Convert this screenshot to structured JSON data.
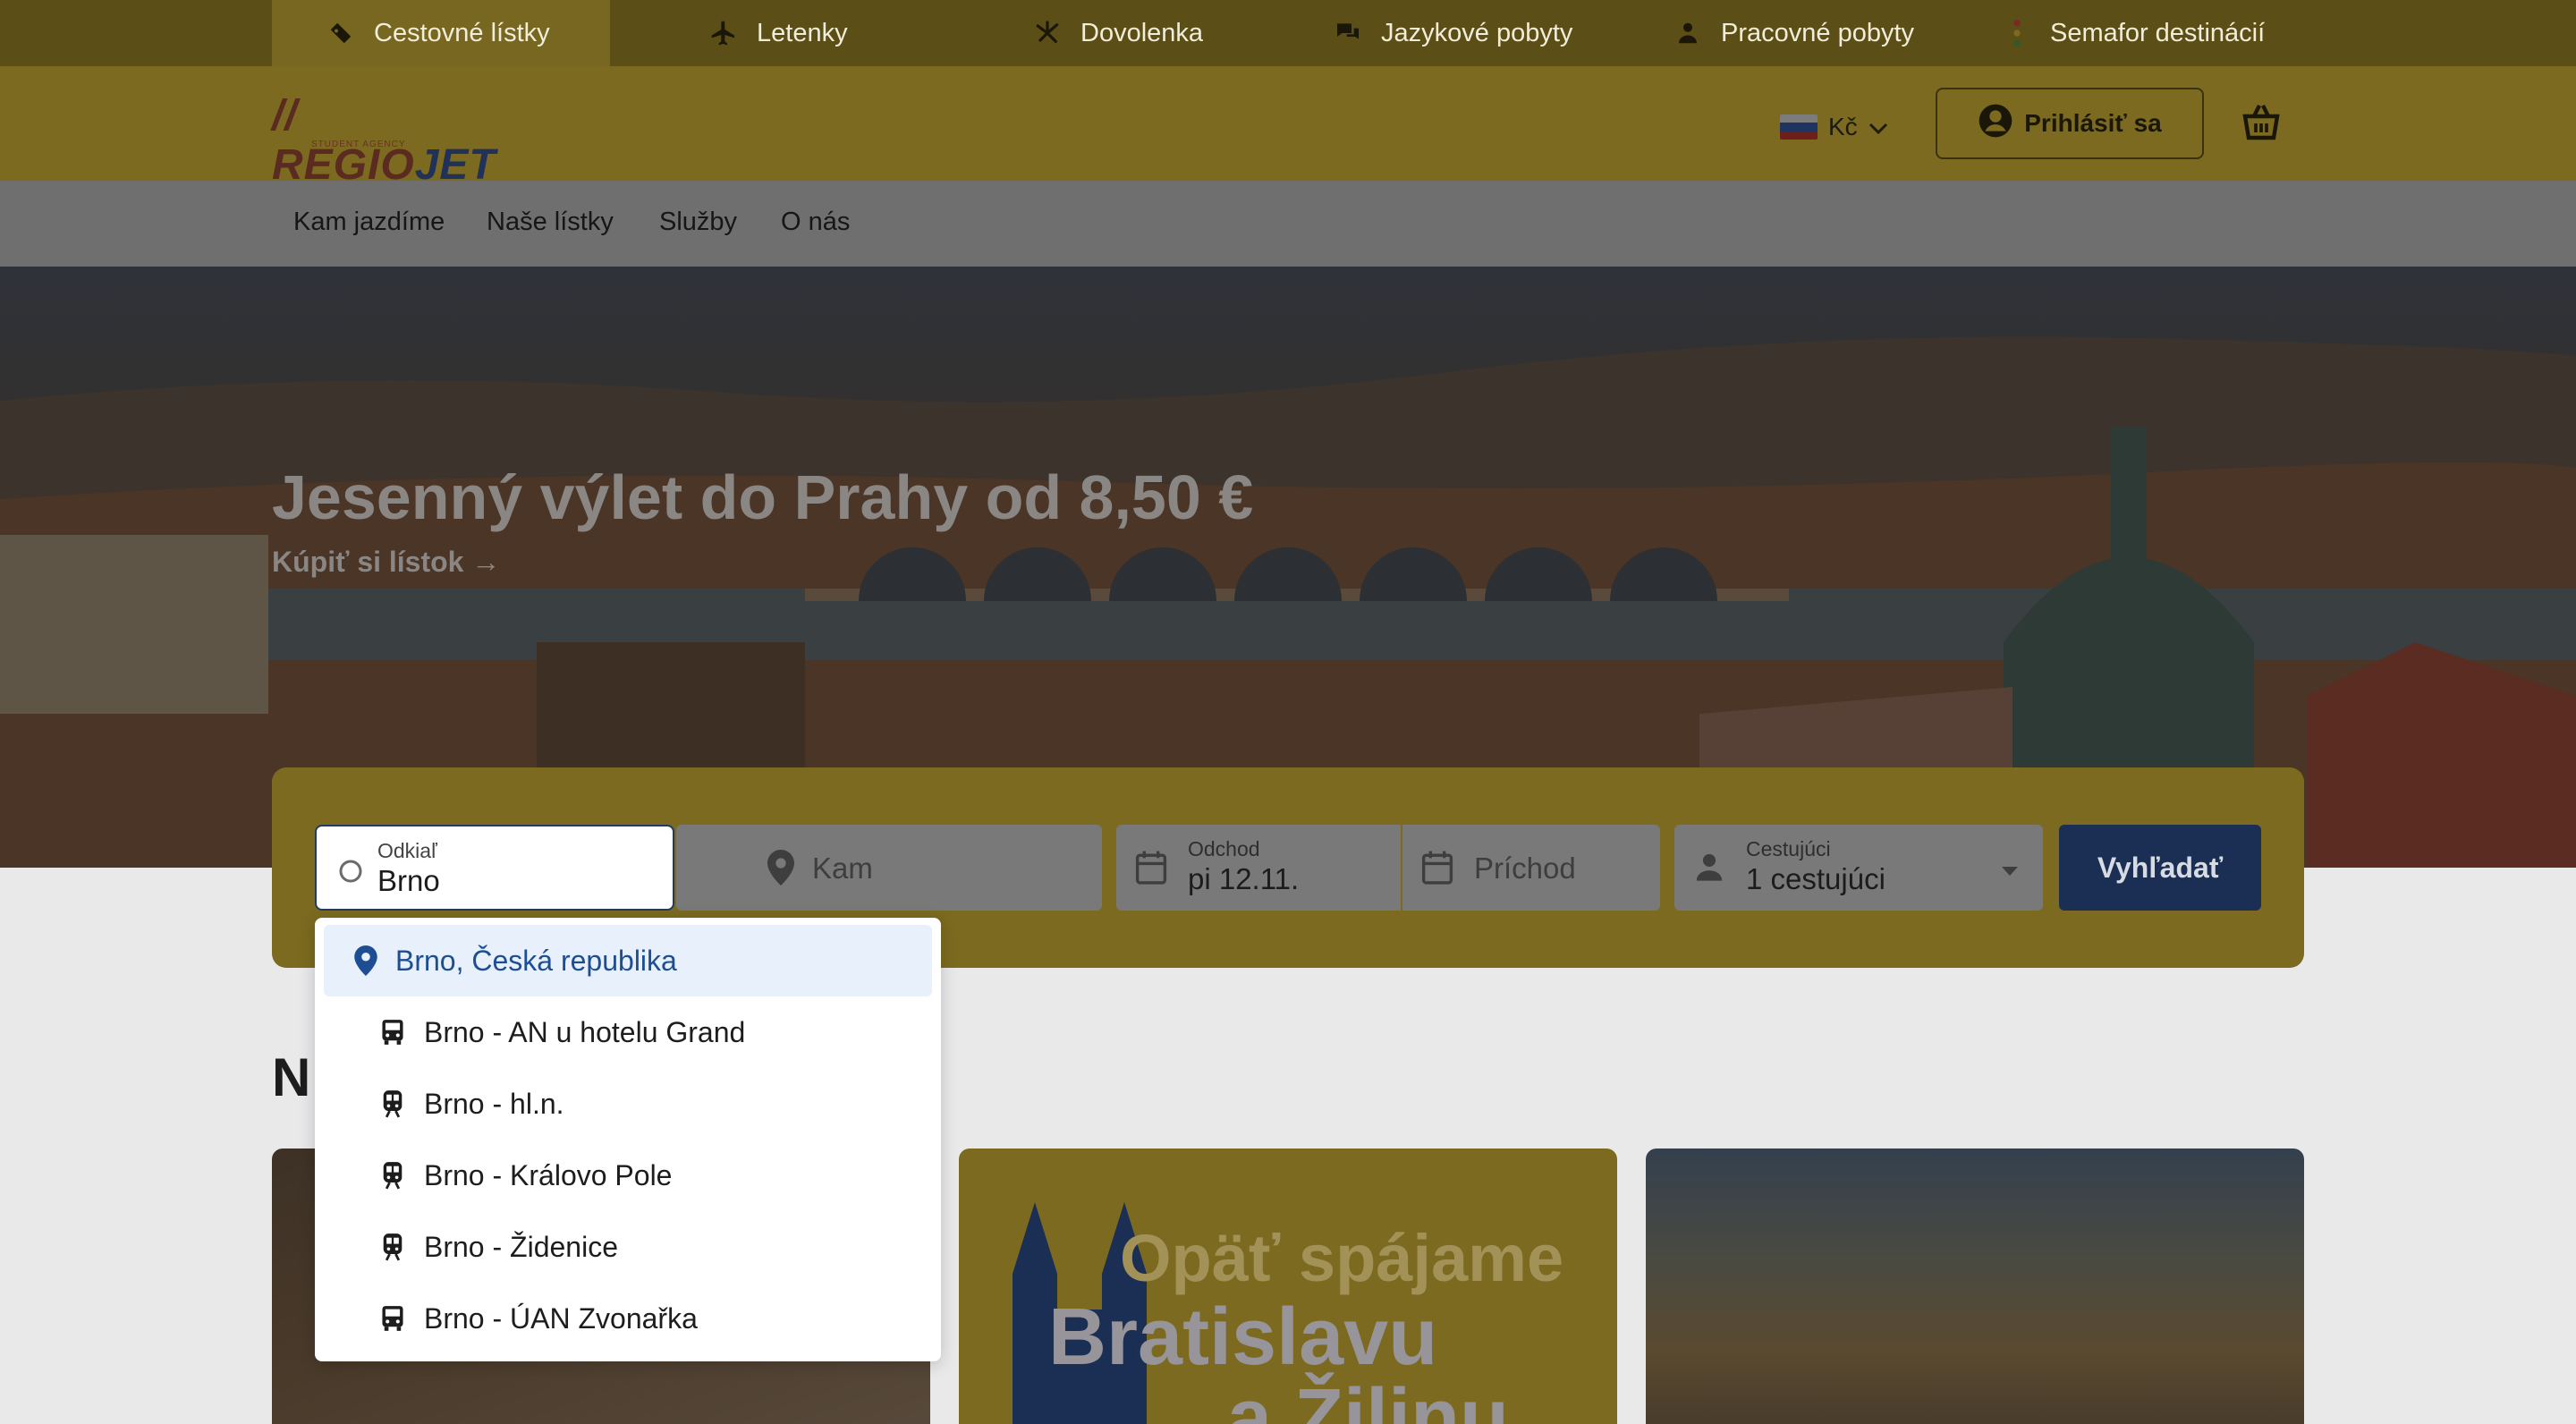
{
  "top_tabs": [
    {
      "label": "Cestovné lístky",
      "icon": "ticket-icon",
      "active": true
    },
    {
      "label": "Letenky",
      "icon": "plane-icon"
    },
    {
      "label": "Dovolenka",
      "icon": "palm-tree-icon"
    },
    {
      "label": "Jazykové pobyty",
      "icon": "chat-bubbles-icon"
    },
    {
      "label": "Pracovné pobyty",
      "icon": "worker-icon"
    },
    {
      "label": "Semafor destinácií",
      "icon": "traffic-light-icon"
    }
  ],
  "header": {
    "logo": {
      "text_a": "REGIO",
      "text_b": "JET",
      "sub": "STUDENT AGENCY"
    },
    "currency": "Kč",
    "login_label": "Prihlásiť sa"
  },
  "nav": [
    "Kam jazdíme",
    "Naše lístky",
    "Služby",
    "O nás"
  ],
  "hero": {
    "title": "Jesenný výlet do Prahy od 8,50 €",
    "link": "Kúpiť si lístok →"
  },
  "search": {
    "from_label": "Odkiaľ",
    "from_value": "Brno",
    "to_placeholder": "Kam",
    "departure_label": "Odchod",
    "departure_value": "pi 12.11.",
    "arrival_placeholder": "Príchod",
    "passengers_label": "Cestujúci",
    "passengers_value": "1 cestujúci",
    "submit_label": "Vyhľadať"
  },
  "suggestions": [
    {
      "label": "Brno, Česká republika",
      "icon": "location-pin-icon",
      "highlighted": true
    },
    {
      "label": "Brno - AN u hotelu Grand",
      "icon": "bus-icon"
    },
    {
      "label": "Brno - hl.n.",
      "icon": "train-icon"
    },
    {
      "label": "Brno - Královo Pole",
      "icon": "train-icon"
    },
    {
      "label": "Brno - Židenice",
      "icon": "train-icon"
    },
    {
      "label": "Brno - ÚAN Zvonařka",
      "icon": "bus-icon"
    }
  ],
  "section_title": "N",
  "promo_card": {
    "line1": "Opäť spájame",
    "line2": "Bratislavu",
    "line3": "a Žilinu"
  },
  "colors": {
    "brand_yellow": "#f4c240",
    "brand_blue": "#1d4e93",
    "overlay": "rgba(0,0,0,0.5)"
  }
}
